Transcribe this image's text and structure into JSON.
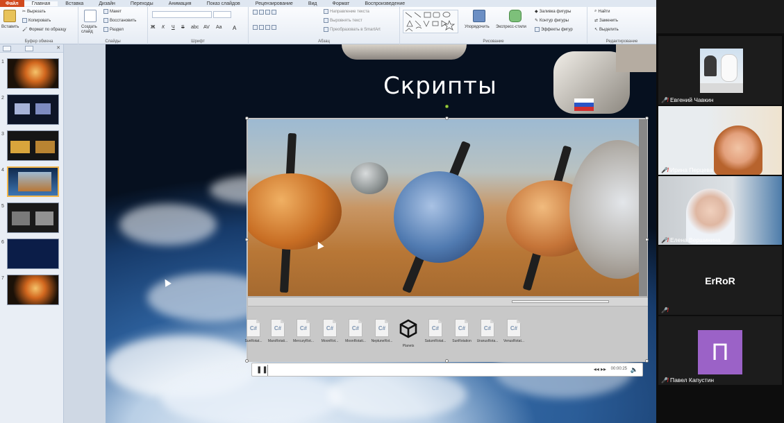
{
  "ribbon": {
    "tabs": [
      "Файл",
      "Главная",
      "Вставка",
      "Дизайн",
      "Переходы",
      "Анимация",
      "Показ слайдов",
      "Рецензирование",
      "Вид",
      "Формат",
      "Воспроизведение"
    ],
    "active_tab": 1,
    "clipboard": {
      "paste": "Вставить",
      "cut": "Вырезать",
      "copy": "Копировать",
      "format_painter": "Формат по образцу",
      "label": "Буфер обмена"
    },
    "slides": {
      "create": "Создать слайд",
      "layout": "Макет",
      "reset": "Восстановить",
      "section": "Раздел",
      "label": "Слайды"
    },
    "font": {
      "label": "Шрифт",
      "bold": "Ж",
      "italic": "К",
      "underline": "Ч",
      "strike": "S",
      "shadow": "abc",
      "spacing": "AV",
      "case": "Aa",
      "color": "A"
    },
    "paragraph": {
      "text_direction": "Направление текста",
      "align_text": "Выровнять текст",
      "smartart": "Преобразовать в SmartArt",
      "label": "Абзац"
    },
    "drawing": {
      "arrange": "Упорядочить",
      "quick_styles": "Экспресс-стили",
      "fill": "Заливка фигуры",
      "outline": "Контур фигуры",
      "effects": "Эффекты фигур",
      "label": "Рисование"
    },
    "editing": {
      "find": "Найти",
      "replace": "Заменить",
      "select": "Выделить",
      "label": "Редактирование"
    }
  },
  "slides_panel": {
    "thumbnails": [
      "1",
      "2",
      "3",
      "4",
      "5",
      "6",
      "7"
    ],
    "selected": 4
  },
  "slide": {
    "title": "Скрипты"
  },
  "video": {
    "assets": [
      {
        "icon": "C#",
        "name": "SunRotat..."
      },
      {
        "icon": "C#",
        "name": "MarsRotati..."
      },
      {
        "icon": "C#",
        "name": "MercuryRot..."
      },
      {
        "icon": "C#",
        "name": "MoonRot..."
      },
      {
        "icon": "C#",
        "name": "MoonRotati..."
      },
      {
        "icon": "C#",
        "name": "NeptuneRot..."
      },
      {
        "icon": "unity",
        "name": "Planets"
      },
      {
        "icon": "C#",
        "name": "SaturnRotat..."
      },
      {
        "icon": "C#",
        "name": "SunRotation"
      },
      {
        "icon": "C#",
        "name": "UranusRota..."
      },
      {
        "icon": "C#",
        "name": "VenusRotat..."
      }
    ],
    "player": {
      "time": "00:00:25",
      "progress": 0.01
    }
  },
  "participants": [
    {
      "name": "Евгений Чавкин",
      "type": "video"
    },
    {
      "name": "Ирина Перцева",
      "type": "video"
    },
    {
      "name": "Елена Вершинина",
      "type": "video"
    },
    {
      "name": "ErRoR",
      "type": "name-only",
      "display": "ErRoR"
    },
    {
      "name": "Павел Капустин",
      "type": "avatar",
      "initial": "П",
      "avatar_color": "#9b62c7"
    }
  ],
  "icons": {
    "muted": "mic-muted-icon",
    "pause": "pause-icon",
    "volume": "volume-icon",
    "unity": "unity-logo-icon"
  }
}
